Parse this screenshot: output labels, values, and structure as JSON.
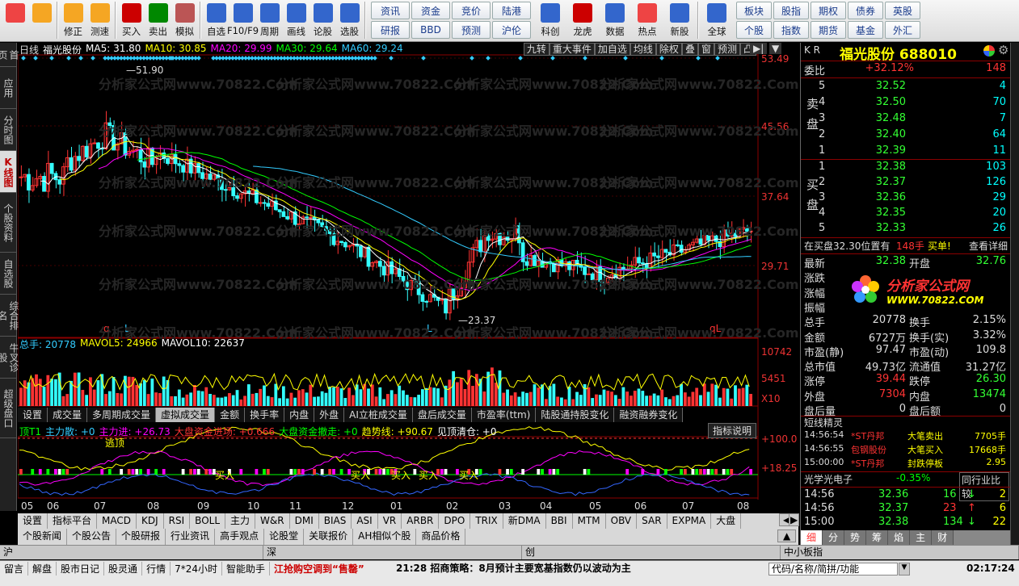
{
  "toolbar": {
    "buttons": [
      {
        "label": "",
        "icon": "layout-grid-icon",
        "color": "#e44"
      },
      {
        "label": "",
        "icon": "back-arrow-icon",
        "color": "#f5a623"
      },
      {
        "label": "修正",
        "icon": "up-arrow-icon",
        "color": "#f5a623"
      },
      {
        "label": "测速",
        "icon": "speed-icon",
        "color": "#f5a623"
      },
      {
        "label": "买入",
        "icon": "buy-icon",
        "color": "#c00"
      },
      {
        "label": "卖出",
        "icon": "sell-icon",
        "color": "#080"
      },
      {
        "label": "模拟",
        "icon": "hammer-icon",
        "color": "#b55"
      },
      {
        "label": "自选",
        "icon": "star-icon",
        "color": "#36c"
      },
      {
        "label": "F10/F9",
        "icon": "f10-icon",
        "color": "#36c"
      },
      {
        "label": "周期",
        "icon": "clock-icon",
        "color": "#36c"
      },
      {
        "label": "画线",
        "icon": "pencil-icon",
        "color": "#36c"
      },
      {
        "label": "论股",
        "icon": "discuss-icon",
        "color": "#36c"
      },
      {
        "label": "选股",
        "icon": "pick-icon",
        "color": "#36c"
      }
    ],
    "grid1": [
      "资讯",
      "资金",
      "竞价",
      "陆港",
      "研报",
      "BBD",
      "预测",
      "沪伦"
    ],
    "buttons2": [
      {
        "label": "科创",
        "icon": "chart-icon",
        "color": "#36c"
      },
      {
        "label": "龙虎",
        "icon": "dragon-icon",
        "color": "#c00"
      },
      {
        "label": "数据",
        "icon": "pe-icon",
        "color": "#36c"
      },
      {
        "label": "热点",
        "icon": "fire-icon",
        "color": "#e44"
      },
      {
        "label": "新股",
        "icon": "ipo-icon",
        "color": "#36c"
      },
      {
        "label": "全球",
        "icon": "globe-icon",
        "color": "#36c"
      }
    ],
    "grid2": [
      "板块",
      "股指",
      "期权",
      "债券",
      "英股",
      "个股",
      "指数",
      "期货",
      "基金",
      "外汇"
    ]
  },
  "leftnav": [
    "首页",
    "应用",
    "分时图",
    "K线图",
    "个股资料",
    "自选股",
    "综合排名",
    "牛叉诊股",
    "超级盘口"
  ],
  "chart": {
    "period": "日线",
    "name": "福光股份",
    "ma": [
      {
        "label": "MA5: 31.80",
        "color": "#fff"
      },
      {
        "label": "MA10: 30.85",
        "color": "#ff0"
      },
      {
        "label": "MA20: 29.99",
        "color": "#f0f"
      },
      {
        "label": "MA30: 29.64",
        "color": "#0f0"
      },
      {
        "label": "MA60: 29.24",
        "color": "#3cf"
      }
    ],
    "topbar": [
      "九转",
      "重大事件",
      "加自选",
      "均线",
      "除权",
      "叠",
      "窗",
      "预测",
      "凸"
    ],
    "price_ticks": [
      "53.49",
      "45.56",
      "37.64",
      "29.71"
    ],
    "high_label": "51.90",
    "low_label": "23.37",
    "vol_line": [
      {
        "label": "总手: 20778",
        "color": "#3cf"
      },
      {
        "label": "MAVOL5: 24966",
        "color": "#ff0"
      },
      {
        "label": "MAVOL10: 22637",
        "color": "#fff"
      }
    ],
    "vol_ticks": [
      "10742",
      "5451",
      "X10"
    ],
    "tabs": [
      "设置",
      "成交量",
      "多周期成交量",
      "虚拟成交量",
      "金额",
      "换手率",
      "内盘",
      "外盘",
      "AI立桩成交量",
      "盘后成交量",
      "市盈率(ttm)",
      "陆股通持股变化",
      "融资融券变化"
    ],
    "ind_line": [
      {
        "label": "顶T1",
        "color": "#0f0"
      },
      {
        "label": "主力散: +0",
        "color": "#3cf"
      },
      {
        "label": "主力进: +26.73",
        "color": "#f0f"
      },
      {
        "label": "大盘资金进场: +0.666",
        "color": "#f33"
      },
      {
        "label": "大盘资金撤走: +0",
        "color": "#0f0"
      },
      {
        "label": "趋势线: +90.67",
        "color": "#ff0"
      },
      {
        "label": "见顶清仓: +0",
        "color": "#fff"
      }
    ],
    "ind_btn": "指标说明",
    "ind_ticks": [
      "+100.0",
      "+18.25"
    ],
    "ind_labels": [
      "逃顶",
      "买入",
      "买入",
      "买入",
      "买入",
      "买入"
    ],
    "xticks": [
      "05",
      "06",
      "07",
      "08",
      "09",
      "10",
      "11",
      "12",
      "01",
      "02",
      "03",
      "04",
      "05",
      "06",
      "07",
      "08"
    ],
    "qlabels": [
      "q",
      "L",
      "L",
      "qL"
    ]
  },
  "bottom_tabs": [
    "设置",
    "指标平台",
    "MACD",
    "KDJ",
    "RSI",
    "BOLL",
    "主力",
    "W&R",
    "DMI",
    "BIAS",
    "ASI",
    "VR",
    "ARBR",
    "DPO",
    "TRIX",
    "新DMA",
    "BBI",
    "MTM",
    "OBV",
    "SAR",
    "EXPMA",
    "大盘"
  ],
  "news_tabs": [
    "个股新闻",
    "个股公告",
    "个股研报",
    "行业资讯",
    "高手观点",
    "论股堂",
    "关联报价",
    "AH相似个股",
    "商品价格"
  ],
  "quote": {
    "title": "福光股份",
    "code": "688010",
    "prefix": "K R",
    "weibi": {
      "label": "委比",
      "value": "+32.12%",
      "diff": "148"
    },
    "sell_label": "卖盘",
    "buy_label": "买盘",
    "sell": [
      {
        "i": "5",
        "p": "32.52",
        "v": "4"
      },
      {
        "i": "4",
        "p": "32.50",
        "v": "70"
      },
      {
        "i": "3",
        "p": "32.48",
        "v": "7"
      },
      {
        "i": "2",
        "p": "32.40",
        "v": "64"
      },
      {
        "i": "1",
        "p": "32.39",
        "v": "11"
      }
    ],
    "buy": [
      {
        "i": "1",
        "p": "32.38",
        "v": "103"
      },
      {
        "i": "2",
        "p": "32.37",
        "v": "126"
      },
      {
        "i": "3",
        "p": "32.36",
        "v": "29"
      },
      {
        "i": "4",
        "p": "32.35",
        "v": "20"
      },
      {
        "i": "5",
        "p": "32.33",
        "v": "26"
      }
    ],
    "order_note": "在买盘32.30位置有",
    "order_qty": "148手",
    "order_act": "买单!",
    "order_link": "查看详细",
    "fields": [
      {
        "a": "最新",
        "av": "32.38",
        "b": "开盘",
        "bv": "32.76"
      },
      {
        "a": "涨跌",
        "av": "",
        "b": "",
        "bv": ""
      },
      {
        "a": "涨幅",
        "av": "",
        "b": "",
        "bv": ""
      },
      {
        "a": "振幅",
        "av": "",
        "b": "",
        "bv": ""
      },
      {
        "a": "总手",
        "av": "20778",
        "b": "换手",
        "bv": "2.15%"
      },
      {
        "a": "金额",
        "av": "6727万",
        "b": "换手(实)",
        "bv": "3.32%"
      },
      {
        "a": "市盈(静)",
        "av": "97.47",
        "b": "市盈(动)",
        "bv": "109.8"
      },
      {
        "a": "总市值",
        "av": "49.73亿",
        "b": "流通值",
        "bv": "31.27亿"
      },
      {
        "a": "涨停",
        "av": "39.44",
        "b": "跌停",
        "bv": "26.30"
      },
      {
        "a": "外盘",
        "av": "7304",
        "b": "内盘",
        "bv": "13474"
      },
      {
        "a": "盘后量",
        "av": "0",
        "b": "盘后额",
        "bv": "0"
      }
    ],
    "logo_text": "分析家公式网",
    "logo_url": "WWW.70822.COM",
    "short_title": "短线精灵",
    "short": [
      {
        "t": "14:56:54",
        "n": "*ST丹邦",
        "e": "大笔卖出",
        "v": "7705手"
      },
      {
        "t": "14:56:55",
        "n": "包钢股份",
        "e": "大笔买入",
        "v": "17668手"
      },
      {
        "t": "15:00:00",
        "n": "*ST丹邦",
        "e": "封跌停板",
        "v": "2.95"
      }
    ],
    "industry": "光学光电子",
    "industry_pct": "-0.35%",
    "compare": "同行业比较",
    "ticks": [
      {
        "t": "14:56",
        "p": "32.36",
        "v": "16",
        "d": "down",
        "n": "2"
      },
      {
        "t": "14:56",
        "p": "32.37",
        "v": "23",
        "d": "up",
        "n": "6"
      },
      {
        "t": "15:00",
        "p": "32.38",
        "v": "134",
        "d": "down",
        "n": "22"
      }
    ],
    "subtabs": [
      "细",
      "分",
      "势",
      "筹",
      "焰",
      "主",
      "财"
    ]
  },
  "bottom1": [
    "沪",
    "深",
    "创",
    "中小板指"
  ],
  "status": [
    "留言",
    "解盘",
    "股市日记",
    "股灵通",
    "行情",
    "7*24小时",
    "智能助手"
  ],
  "ticker_main": "江抢购空调到“售罄”",
  "ticker_time": "21:28",
  "ticker_title": "招商策略：8月预计主要宽基指数仍以波动为主",
  "search_placeholder": "代码/名称/简拼/功能",
  "clock": "02:17:24",
  "watermark": "分析家公式网www.70822.Com"
}
